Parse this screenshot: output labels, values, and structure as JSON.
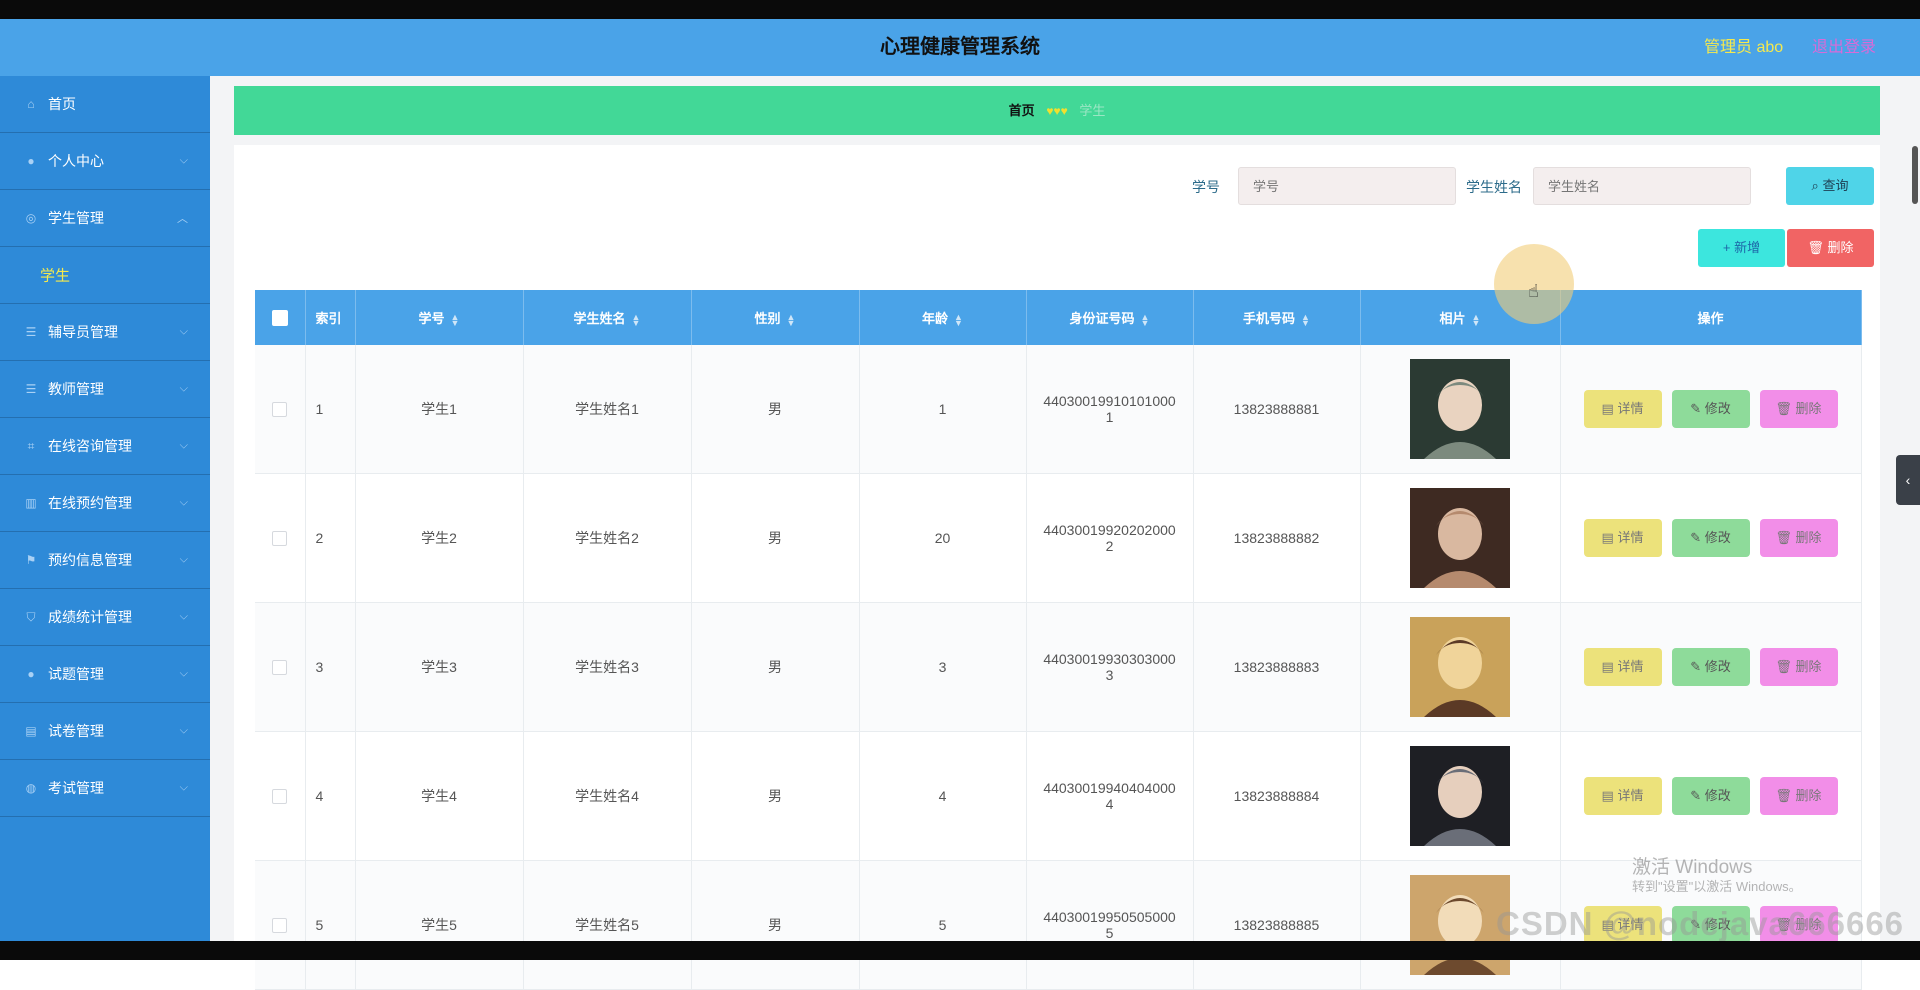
{
  "header": {
    "title": "心理健康管理系统",
    "admin_label": "管理员 abo",
    "logout_label": "退出登录"
  },
  "sidebar": {
    "items": [
      {
        "label": "首页",
        "icon": "home-icon"
      },
      {
        "label": "个人中心",
        "icon": "user-icon"
      },
      {
        "label": "学生管理",
        "icon": "student-icon",
        "expanded": true,
        "sub": "学生"
      },
      {
        "label": "辅导员管理",
        "icon": "menu-icon"
      },
      {
        "label": "教师管理",
        "icon": "menu-icon"
      },
      {
        "label": "在线咨询管理",
        "icon": "crop-icon"
      },
      {
        "label": "在线预约管理",
        "icon": "book-icon"
      },
      {
        "label": "预约信息管理",
        "icon": "flag-icon"
      },
      {
        "label": "成绩统计管理",
        "icon": "shield-icon"
      },
      {
        "label": "试题管理",
        "icon": "user-icon"
      },
      {
        "label": "试卷管理",
        "icon": "paper-icon"
      },
      {
        "label": "考试管理",
        "icon": "globe-icon"
      }
    ]
  },
  "breadcrumb": {
    "home": "首页",
    "separator": "♥♥♥",
    "current": "学生"
  },
  "search": {
    "student_no_label": "学号",
    "student_no_placeholder": "学号",
    "student_name_label": "学生姓名",
    "student_name_placeholder": "学生姓名",
    "query_label": "查询"
  },
  "toolbar": {
    "add_label": "新增",
    "delete_label": "删除"
  },
  "table": {
    "columns": [
      "索引",
      "学号",
      "学生姓名",
      "性别",
      "年龄",
      "身份证号码",
      "手机号码",
      "相片",
      "操作"
    ],
    "rows": [
      {
        "index": "1",
        "no": "学生1",
        "name": "学生姓名1",
        "gender": "男",
        "age": "1",
        "id_l1": "44030019910101000",
        "id_l2": "1",
        "phone": "13823888881"
      },
      {
        "index": "2",
        "no": "学生2",
        "name": "学生姓名2",
        "gender": "男",
        "age": "20",
        "id_l1": "44030019920202000",
        "id_l2": "2",
        "phone": "13823888882"
      },
      {
        "index": "3",
        "no": "学生3",
        "name": "学生姓名3",
        "gender": "男",
        "age": "3",
        "id_l1": "44030019930303000",
        "id_l2": "3",
        "phone": "13823888883"
      },
      {
        "index": "4",
        "no": "学生4",
        "name": "学生姓名4",
        "gender": "男",
        "age": "4",
        "id_l1": "44030019940404000",
        "id_l2": "4",
        "phone": "13823888884"
      },
      {
        "index": "5",
        "no": "学生5",
        "name": "学生姓名5",
        "gender": "男",
        "age": "5",
        "id_l1": "44030019950505000",
        "id_l2": "5",
        "phone": "13823888885"
      }
    ],
    "actions": {
      "detail": "详情",
      "edit": "修改",
      "remove": "删除"
    }
  },
  "watermark": {
    "line1": "激活 Windows",
    "line2": "转到\"设置\"以激活 Windows。",
    "csdn": "CSDN @nodejava666666"
  },
  "colors": {
    "header": "#4aa3e8",
    "sidebar": "#2e8ad8",
    "breadcrumb": "#42d897",
    "accent_yellow": "#f5e94d"
  }
}
